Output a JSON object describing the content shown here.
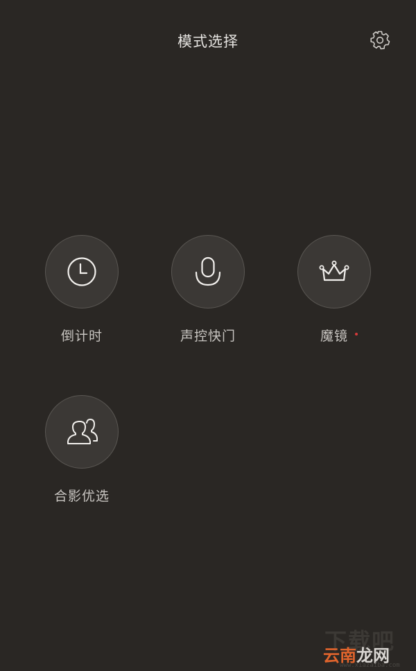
{
  "header": {
    "title": "模式选择",
    "settings_icon": "gear-icon"
  },
  "modes": [
    {
      "id": "timer",
      "label": "倒计时",
      "icon": "clock-icon",
      "has_new_dot": false
    },
    {
      "id": "voice",
      "label": "声控快门",
      "icon": "microphone-icon",
      "has_new_dot": false
    },
    {
      "id": "magic",
      "label": "魔镜",
      "icon": "crown-icon",
      "has_new_dot": true
    },
    {
      "id": "group",
      "label": "合影优选",
      "icon": "people-icon",
      "has_new_dot": false
    }
  ],
  "watermark": {
    "top_text": "下载吧",
    "brand_part1": "云南",
    "brand_part2": "龙网",
    "url": "www.xiazaiba.com"
  },
  "colors": {
    "background": "#2a2724",
    "circle_fill": "#3b3835",
    "circle_border": "#5a5753",
    "text": "#c8c5c1",
    "new_dot": "#d63a3a",
    "brand_orange": "#e0642c"
  }
}
